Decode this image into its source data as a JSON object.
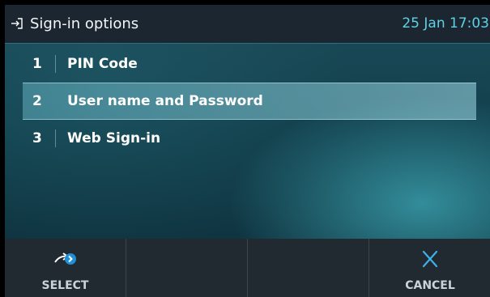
{
  "header": {
    "title": "Sign-in options",
    "datetime": "25 Jan 17:03",
    "icon": "sign-in-arrow-icon"
  },
  "list": {
    "items": [
      {
        "number": "1",
        "label": "PIN Code",
        "selected": false
      },
      {
        "number": "2",
        "label": "User name and Password",
        "selected": true
      },
      {
        "number": "3",
        "label": "Web Sign-in",
        "selected": false
      }
    ]
  },
  "softkeys": [
    {
      "label": "SELECT",
      "icon": "select-arrow-icon"
    },
    {
      "label": "",
      "icon": ""
    },
    {
      "label": "",
      "icon": ""
    },
    {
      "label": "CANCEL",
      "icon": "close-icon"
    }
  ],
  "colors": {
    "header_bg": "#1b2630",
    "accent": "#5ed3e6",
    "softkey_bg": "#212a31"
  }
}
